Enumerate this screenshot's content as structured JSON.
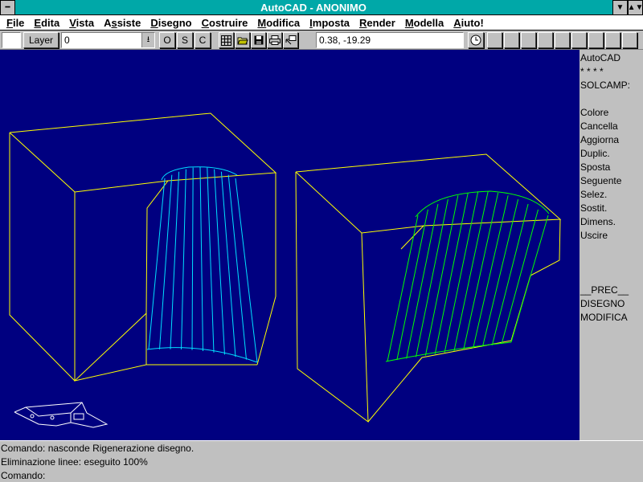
{
  "window": {
    "title": "AutoCAD - ANONIMO",
    "system_icon": "minus-icon",
    "scroll_up_icon": "triangle-up-icon",
    "scroll_down_icon": "triangle-down-icon"
  },
  "menu": [
    {
      "pre": "",
      "u": "F",
      "post": "ile"
    },
    {
      "pre": "",
      "u": "E",
      "post": "dita"
    },
    {
      "pre": "",
      "u": "V",
      "post": "ista"
    },
    {
      "pre": "A",
      "u": "s",
      "post": "siste"
    },
    {
      "pre": "",
      "u": "D",
      "post": "isegno"
    },
    {
      "pre": "",
      "u": "C",
      "post": "ostruire"
    },
    {
      "pre": "",
      "u": "M",
      "post": "odifica"
    },
    {
      "pre": "",
      "u": "I",
      "post": "mposta"
    },
    {
      "pre": "",
      "u": "R",
      "post": "ender"
    },
    {
      "pre": "",
      "u": "M",
      "post": "odella"
    },
    {
      "pre": "",
      "u": "A",
      "post": "iuto!"
    }
  ],
  "toolbar": {
    "layer_button": "Layer",
    "layer_value": "0",
    "dropdown_icon": "arrow-down-icon",
    "o_button": "O",
    "s_button": "S",
    "c_button": "C",
    "coordinates": "0.38, -19.29",
    "tool_icons": [
      "grid-icon",
      "open-folder-icon",
      "save-icon",
      "print-icon",
      "pointer-icon"
    ],
    "clock_icon": "clock-icon"
  },
  "side_menu": {
    "items": [
      "AutoCAD",
      "* * * *",
      "SOLCAMP:",
      "",
      "Colore",
      "Cancella",
      "Aggiorna",
      "Duplic.",
      "Sposta",
      "Seguente",
      "Selez.",
      "Sostit.",
      "Dimens.",
      "Uscire",
      "",
      "",
      "",
      "__PREC__",
      "DISEGNO",
      "MODIFICA"
    ]
  },
  "command": {
    "lines": [
      "Comando: nasconde Rigenerazione disegno.",
      "Eliminazione linee: eseguito 100%",
      "Comando:"
    ]
  },
  "colors": {
    "titlebar": "#00a8a8",
    "drawing_bg": "#000080",
    "edge_yellow": "#ffff00",
    "surface_cyan": "#00e0ff",
    "surface_green": "#00ff00",
    "ucs_white": "#ffffff"
  }
}
